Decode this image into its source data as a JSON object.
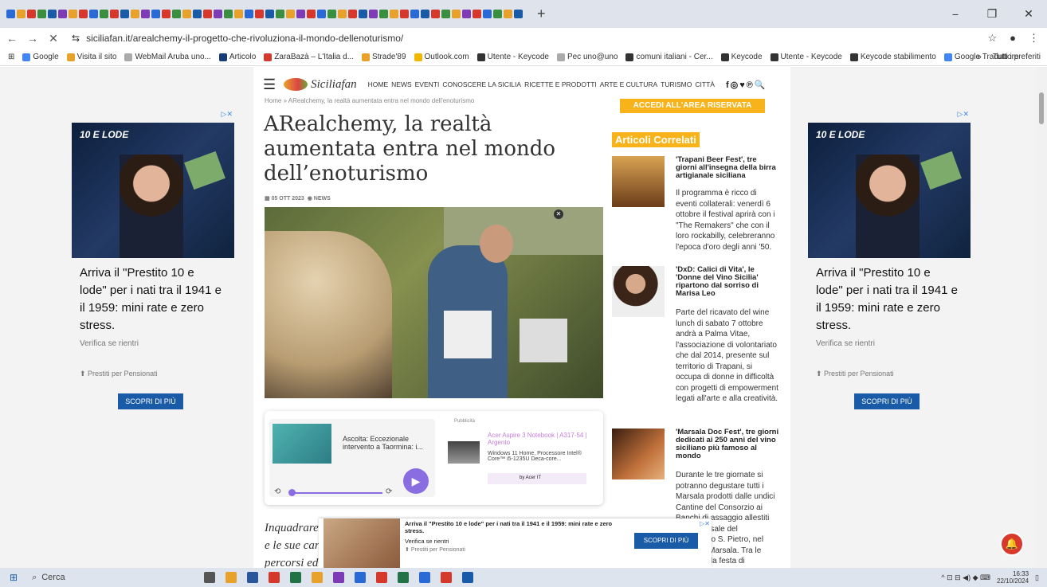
{
  "browser": {
    "tab_icon_colors": [
      "#2a6ad6",
      "#e8a22b",
      "#d6382c",
      "#3a8e3f",
      "#1a5ba8",
      "#7d3bb5",
      "#e8a22b",
      "#d6382c",
      "#2a6ad6",
      "#3a8e3f",
      "#d6382c",
      "#1a5ba8",
      "#e8a22b",
      "#7d3bb5",
      "#2a6ad6",
      "#d6382c",
      "#3a8e3f",
      "#e8a22b",
      "#1a5ba8",
      "#d6382c",
      "#7d3bb5",
      "#3a8e3f",
      "#e8a22b",
      "#2a6ad6",
      "#d6382c",
      "#1a5ba8",
      "#3a8e3f",
      "#e8a22b",
      "#7d3bb5",
      "#d6382c",
      "#2a6ad6",
      "#3a8e3f",
      "#e8a22b",
      "#d6382c",
      "#1a5ba8",
      "#7d3bb5",
      "#3a8e3f",
      "#e8a22b",
      "#d6382c",
      "#2a6ad6",
      "#1a5ba8",
      "#d6382c",
      "#3a8e3f",
      "#e8a22b",
      "#7d3bb5",
      "#d6382c",
      "#2a6ad6",
      "#3a8e3f",
      "#e8a22b",
      "#1a5ba8"
    ],
    "new_tab": "+",
    "minimize": "−",
    "maximize": "❐",
    "close": "✕",
    "back": "←",
    "forward": "→",
    "stop": "✕",
    "site_info": "⇆",
    "url": "siciliafan.it/arealchemy-il-progetto-che-rivoluziona-il-mondo-dellenoturismo/",
    "star": "☆",
    "menu": "⋮",
    "apps": "⊞",
    "bookmarks": [
      {
        "label": "Google",
        "color": "#4285f4"
      },
      {
        "label": "Visita il sito",
        "color": "#e8a22b"
      },
      {
        "label": "WebMail Aruba uno...",
        "color": "#aaa"
      },
      {
        "label": "Articolo",
        "color": "#1a3c7a"
      },
      {
        "label": "ZaraBazà – L'Italia d...",
        "color": "#d6382c"
      },
      {
        "label": "Strade'89",
        "color": "#e8a22b"
      },
      {
        "label": "Outlook.com",
        "color": "#f2b705"
      },
      {
        "label": "Utente - Keycode",
        "color": "#333"
      },
      {
        "label": "Pec uno@uno",
        "color": "#aaa"
      },
      {
        "label": "comuni italiani - Cer...",
        "color": "#333"
      },
      {
        "label": "Keycode",
        "color": "#333"
      },
      {
        "label": "Utente - Keycode",
        "color": "#333"
      },
      {
        "label": "Keycode stabilimento",
        "color": "#333"
      },
      {
        "label": "Google Traduttore",
        "color": "#4285f4"
      }
    ],
    "bookmarks_more": "»",
    "all_bookmarks": "Tutti i preferiti"
  },
  "site": {
    "logo_text": "Siciliafan",
    "menu": [
      "HOME",
      "NEWS",
      "EVENTI",
      "CONOSCERE LA SICILIA",
      "RICETTE E PRODOTTI",
      "ARTE E CULTURA",
      "TURISMO",
      "CITTÀ"
    ],
    "social": "f◎♥℗🔍",
    "breadcrumb": "Home » ARealchemy, la realtà aumentata entra nel mondo dell'enoturismo",
    "title": "ARealchemy, la realtà aumentata entra nel mondo dell’enoturismo",
    "date": "05 OTT 2023",
    "category": "NEWS",
    "article_lines": [
      "Inquadrare",
      "e le sue car",
      "percorsi ed"
    ]
  },
  "player": {
    "title": "Ascolta: Eccezionale intervento a Taormina: i...",
    "ad_label": "Pubblicità",
    "product": "Acer Aspire 3 Notebook | A317-54 | Argento",
    "desc": "Windows 11 Home, Processore Intel® Core™ i5-1235U Deca-core...",
    "by": "by Acer IT",
    "rewind": "⟲",
    "forward": "⟳",
    "play": "▶"
  },
  "sidebar": {
    "access": "ACCEDI ALL'AREA RISERVATA",
    "related_heading": "Articoli Correlati",
    "items": [
      {
        "title": "'Trapani Beer Fest', tre giorni all'insegna della birra artigianale siciliana",
        "text": "Il programma è ricco di eventi collaterali: venerdì 6 ottobre il festival aprirà con i \"The Remakers\" che con il loro rockabilly, celebreranno l'epoca d'oro degli anni '50."
      },
      {
        "title": "'DxD: Calici di Vita', le 'Donne del Vino Sicilia' ripartono dal sorriso di Marisa Leo",
        "text": "Parte del ricavato del wine lunch di sabato 7 ottobre andrà a Palma Vitae, l'associazione di volontariato che dal 2014, presente sul territorio di Trapani, si occupa di donne in difficoltà con progetti di empowerment legati all'arte e alla creatività."
      },
      {
        "title": "'Marsala Doc Fest', tre giorni dedicati ai 250 anni del vino siciliano più famoso al mondo",
        "text": "Durante le tre giornate si potranno degustare tutti i Marsala prodotti dalle undici Cantine del Consorzio ai Banchi di assaggio allestiti presso le sale del Complesso S. Pietro, nel centro di Marsala. Tra le iniziative, la festa di"
      }
    ]
  },
  "ad": {
    "brand": "10 E LODE",
    "headline": "Arriva il \"Prestito 10 e lode\" per i nati tra il 1941 e il 1959: mini rate e zero stress.",
    "sub": "Verifica se rientri",
    "sponsor": "Prestiti per Pensionati",
    "cta": "SCOPRI DI PIÙ",
    "adchoices": "▷✕"
  },
  "taskbar": {
    "start": "⊞",
    "search": "Cerca",
    "app_colors": [
      "#555",
      "#e8a22b",
      "#2b579a",
      "#d6382c",
      "#217346",
      "#e8a22b",
      "#7d3bb5",
      "#2a6ad6",
      "#d6382c",
      "#217346",
      "#2a6ad6",
      "#d6382c",
      "#1a5ba8"
    ],
    "tray": "^ ⊡ ⊟ ◀) ◆ ⌨",
    "time": "16:33",
    "date": "22/10/2024",
    "notify": "▯"
  },
  "notification_bell": "🔔"
}
